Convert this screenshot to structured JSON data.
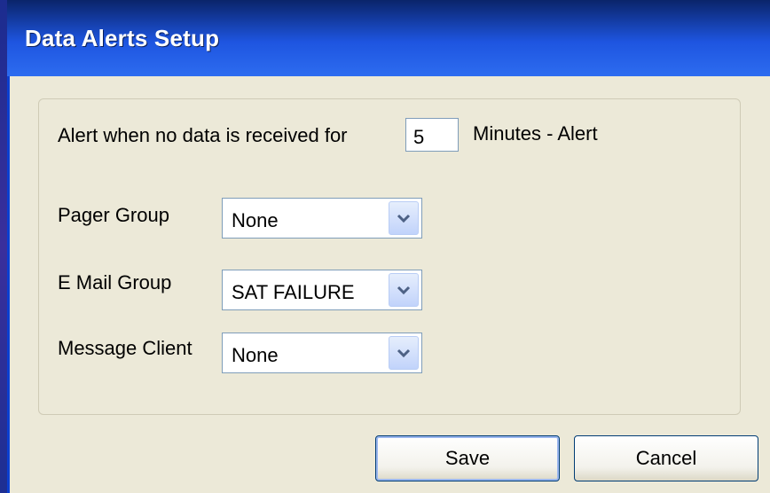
{
  "window": {
    "title": "Data Alerts Setup"
  },
  "alert": {
    "prefix": "Alert when no data is received for",
    "minutes_value": "5",
    "suffix": "Minutes - Alert"
  },
  "fields": {
    "pager_group": {
      "label": "Pager Group",
      "value": "None"
    },
    "email_group": {
      "label": "E Mail Group",
      "value": "SAT FAILURE"
    },
    "message_client": {
      "label": "Message Client",
      "value": "None"
    }
  },
  "buttons": {
    "save": "Save",
    "cancel": "Cancel"
  },
  "colors": {
    "titlebar": "#1e55e0",
    "window_bg": "#ece9d8",
    "border_blue": "#003c74"
  },
  "icons": {
    "dropdown": "chevron-down-icon"
  }
}
